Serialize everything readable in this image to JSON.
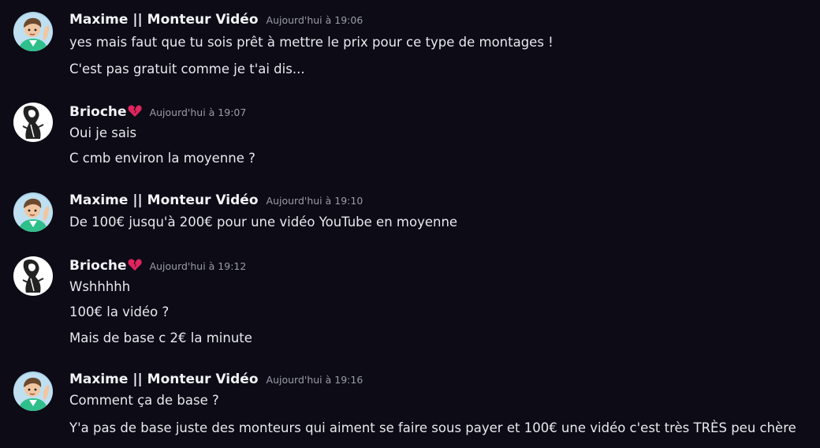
{
  "colors": {
    "background": "#0c0b16",
    "username": "#f2f3f5",
    "timestamp": "#9b9ca8",
    "text": "#e8e9ec",
    "heart": "#e0245e"
  },
  "messages": [
    {
      "author": "Maxime || Monteur Vidéo",
      "avatar": "maxime-avatar",
      "timestamp": "Aujourd'hui à 19:06",
      "lines": [
        "yes mais faut que tu sois prêt à mettre le prix pour ce type de montages !",
        "C'est pas gratuit comme je t'ai dis..."
      ]
    },
    {
      "author": "Brioche",
      "avatar": "brioche-avatar",
      "badge_icon": "broken-heart-icon",
      "timestamp": "Aujourd'hui à 19:07",
      "lines": [
        "Oui je sais",
        "C cmb environ la moyenne ?"
      ]
    },
    {
      "author": "Maxime || Monteur Vidéo",
      "avatar": "maxime-avatar",
      "timestamp": "Aujourd'hui à 19:10",
      "lines": [
        "De 100€ jusqu'à 200€ pour une vidéo YouTube en moyenne"
      ]
    },
    {
      "author": "Brioche",
      "avatar": "brioche-avatar",
      "badge_icon": "broken-heart-icon",
      "timestamp": "Aujourd'hui à 19:12",
      "lines": [
        "Wshhhhh",
        "100€ la vidéo ?",
        "Mais de base c 2€ la minute"
      ]
    },
    {
      "author": "Maxime || Monteur Vidéo",
      "avatar": "maxime-avatar",
      "timestamp": "Aujourd'hui à 19:16",
      "lines": [
        "Comment ça de base ?",
        "Y'a pas de base juste des monteurs qui aiment se faire sous payer et 100€ une vidéo c'est très TRÈS peu chère"
      ]
    }
  ]
}
